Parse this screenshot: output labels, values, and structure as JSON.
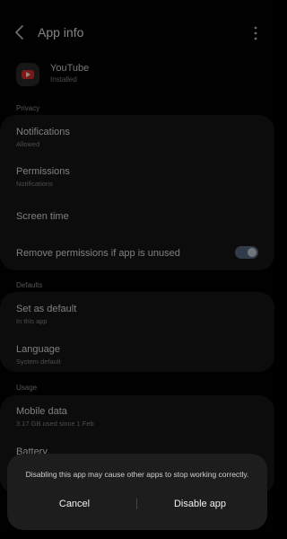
{
  "header": {
    "title": "App info"
  },
  "app": {
    "name": "YouTube",
    "status": "Installed"
  },
  "sections": {
    "privacy": "Privacy",
    "defaults": "Defaults",
    "usage": "Usage"
  },
  "privacy_items": {
    "notifications": {
      "title": "Notifications",
      "subtitle": "Allowed"
    },
    "permissions": {
      "title": "Permissions",
      "subtitle": "Notifications"
    },
    "screen_time": {
      "title": "Screen time"
    },
    "remove_permissions": {
      "title": "Remove permissions if app is unused",
      "enabled": true
    }
  },
  "defaults_items": {
    "set_as_default": {
      "title": "Set as default",
      "subtitle": "In this app"
    },
    "language": {
      "title": "Language",
      "subtitle": "System default"
    }
  },
  "usage_items": {
    "mobile_data": {
      "title": "Mobile data",
      "subtitle": "3.17 GB used since 1 Feb"
    },
    "battery": {
      "title": "Battery"
    }
  },
  "dialog": {
    "message": "Disabling this app may cause other apps to stop working correctly.",
    "cancel_label": "Cancel",
    "disable_label": "Disable app"
  },
  "colors": {
    "background": "#030303",
    "card": "#171717",
    "toggle_on": "#5a6c86",
    "youtube_red": "#d9312d"
  }
}
